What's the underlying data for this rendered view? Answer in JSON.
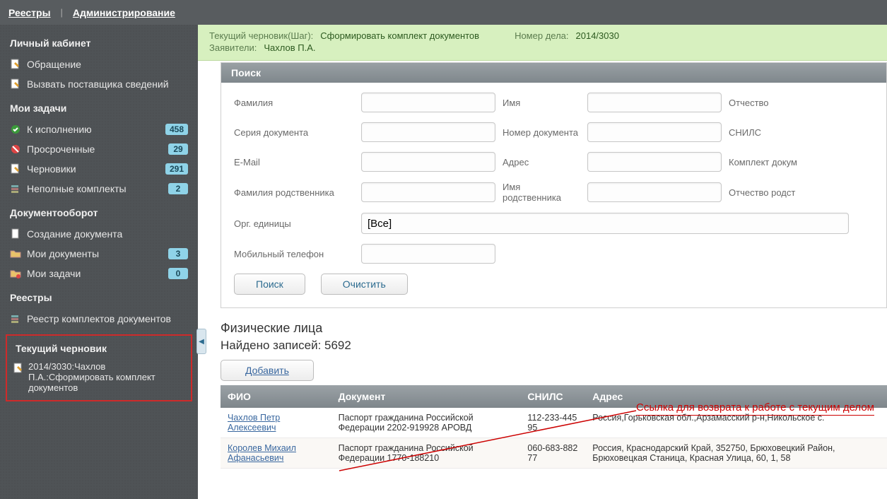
{
  "topnav": {
    "registries": "Реестры",
    "admin": "Администрирование"
  },
  "sidebar": {
    "cabinet_title": "Личный кабинет",
    "cabinet": [
      {
        "label": "Обращение"
      },
      {
        "label": "Вызвать поставщика сведений"
      }
    ],
    "tasks_title": "Мои задачи",
    "tasks": [
      {
        "label": "К исполнению",
        "badge": "458"
      },
      {
        "label": "Просроченные",
        "badge": "29"
      },
      {
        "label": "Черновики",
        "badge": "291"
      },
      {
        "label": "Неполные комплекты",
        "badge": "2"
      }
    ],
    "docflow_title": "Документооборот",
    "docflow": [
      {
        "label": "Создание документа",
        "badge": ""
      },
      {
        "label": "Мои документы",
        "badge": "3"
      },
      {
        "label": "Мои задачи",
        "badge": "0"
      }
    ],
    "registries_title": "Реестры",
    "registries": [
      {
        "label": "Реестр комплектов документов"
      }
    ],
    "draft_title": "Текущий черновик",
    "draft_item": "2014/3030:Чахлов П.А.:Сформировать комплект документов"
  },
  "infobar": {
    "step_label": "Текущий черновик(Шаг):",
    "step_value": "Сформировать комплект документов",
    "case_label": "Номер дела:",
    "case_value": "2014/3030",
    "applicants_label": "Заявители:",
    "applicants_value": "Чахлов П.А."
  },
  "search": {
    "header": "Поиск",
    "fields": {
      "lastname": "Фамилия",
      "firstname": "Имя",
      "patronymic": "Отчество",
      "doc_series": "Серия документа",
      "doc_number": "Номер документа",
      "snils": "СНИЛС",
      "email": "E-Mail",
      "address": "Адрес",
      "docset": "Комплект докум",
      "rel_lastname": "Фамилия родственника",
      "rel_firstname": "Имя родственника",
      "rel_patronymic": "Отчество родст",
      "org_units": "Орг. единицы",
      "org_units_value": "[Все]",
      "mobile": "Мобильный телефон"
    },
    "buttons": {
      "search": "Поиск",
      "clear": "Очистить",
      "add": "Добавить"
    }
  },
  "annotation": "Ссылка для возврата к работе с текущим делом",
  "results": {
    "title": "Физические лица",
    "count_label": "Найдено записей: 5692",
    "columns": {
      "fio": "ФИО",
      "doc": "Документ",
      "snils": "СНИЛС",
      "address": "Адрес"
    },
    "rows": [
      {
        "fio": "Чахлов Петр Алексеевич",
        "doc": "Паспорт гражданина Российской Федерации 2202-919928 АРОВД",
        "snils": "112-233-445 95",
        "address": "Россия,Горьковская обл.,Арзамасский р-н,Никольское с."
      },
      {
        "fio": "Королев Михаил Афанасьевич",
        "doc": "Паспорт гражданина Российской Федерации 1770-188210",
        "snils": "060-683-882 77",
        "address": "Россия, Краснодарский Край, 352750, Брюховецкий Район, Брюховецкая Станица, Красная Улица, 60, 1, 58"
      }
    ]
  }
}
